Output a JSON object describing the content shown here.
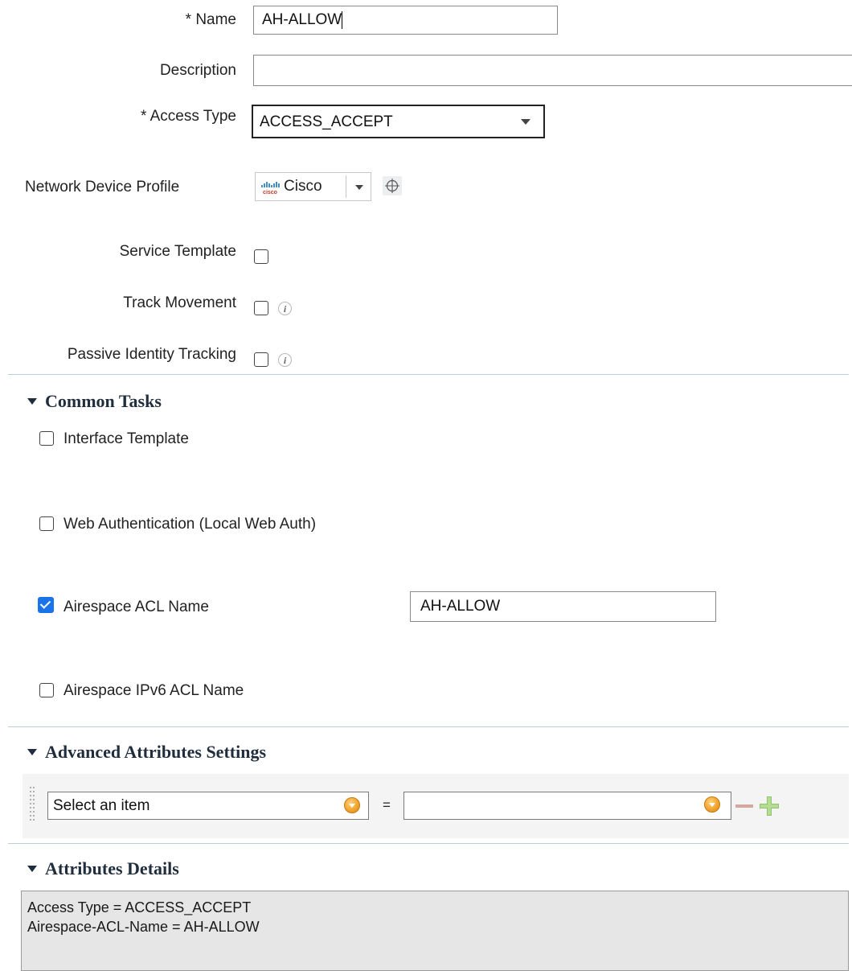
{
  "form": {
    "name_label": "* Name",
    "name_value": "AH-ALLOW",
    "description_label": "Description",
    "description_value": "",
    "access_type_label": "* Access Type",
    "access_type_value": "ACCESS_ACCEPT",
    "ndp_label": "Network Device Profile",
    "ndp_value": "Cisco",
    "service_template_label": "Service Template",
    "track_movement_label": "Track Movement",
    "passive_identity_label": "Passive Identity Tracking"
  },
  "common_tasks": {
    "title": "Common Tasks",
    "items": [
      {
        "label": "Interface Template",
        "checked": false
      },
      {
        "label": "Web Authentication (Local Web Auth)",
        "checked": false
      },
      {
        "label": "Airespace ACL Name",
        "checked": true,
        "value": "AH-ALLOW"
      },
      {
        "label": "Airespace IPv6 ACL Name",
        "checked": false
      }
    ]
  },
  "advanced": {
    "title": "Advanced Attributes Settings",
    "select_placeholder": "Select an item",
    "equals": "=",
    "value": ""
  },
  "details": {
    "title": "Attributes Details",
    "lines": [
      "Access Type = ACCESS_ACCEPT",
      "Airespace-ACL-Name = AH-ALLOW"
    ]
  },
  "icons": {
    "cisco_logo": "cisco-logo-icon",
    "target": "crosshair-icon",
    "info": "info-icon",
    "minus": "minus-icon",
    "plus": "plus-icon"
  },
  "colors": {
    "checkbox_checked": "#1a73e8",
    "section_heading": "#1f2d3d",
    "details_bg": "#e6e6e6",
    "orange_button": "#f0a12b",
    "plus_green": "#8fc46b"
  }
}
